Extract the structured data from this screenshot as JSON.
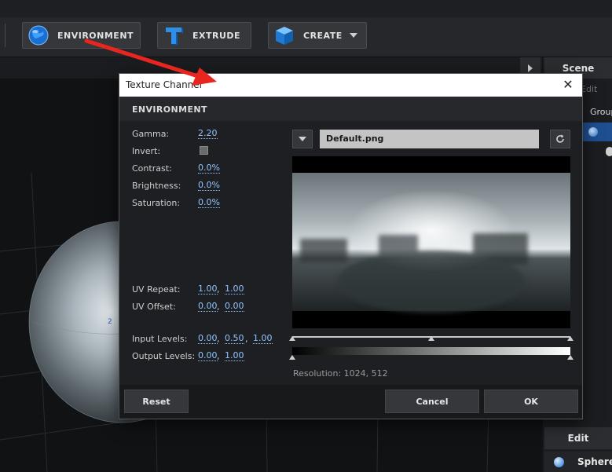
{
  "toolbar": {
    "environment_label": "ENVIRONMENT",
    "extrude_label": "EXTRUDE",
    "create_label": "CREATE"
  },
  "right_panel": {
    "scene_tab": "Scene",
    "edit_menu": "Edit",
    "group_label": "Group",
    "edit_section": "Edit",
    "sphere_item": "Sphere"
  },
  "dialog": {
    "title": "Texture Channel",
    "section_title": "ENVIRONMENT",
    "params": {
      "gamma_label": "Gamma:",
      "gamma_value": "2.20",
      "invert_label": "Invert:",
      "contrast_label": "Contrast:",
      "contrast_value": "0.0%",
      "brightness_label": "Brightness:",
      "brightness_value": "0.0%",
      "saturation_label": "Saturation:",
      "saturation_value": "0.0%",
      "uv_repeat_label": "UV Repeat:",
      "uv_repeat_u": "1.00",
      "uv_repeat_v": "1.00",
      "uv_offset_label": "UV Offset:",
      "uv_offset_u": "0.00",
      "uv_offset_v": "0.00",
      "input_levels_label": "Input Levels:",
      "input_levels_low": "0.00",
      "input_levels_mid": "0.50",
      "input_levels_high": "1.00",
      "output_levels_label": "Output Levels:",
      "output_levels_low": "0.00",
      "output_levels_high": "1.00",
      "separator": ","
    },
    "texture": {
      "filename": "Default.png",
      "resolution": "Resolution: 1024, 512"
    },
    "buttons": {
      "reset": "Reset",
      "cancel": "Cancel",
      "ok": "OK"
    }
  },
  "colors": {
    "accent_link": "#8fc4ff",
    "annotation_arrow": "#e8251f"
  }
}
